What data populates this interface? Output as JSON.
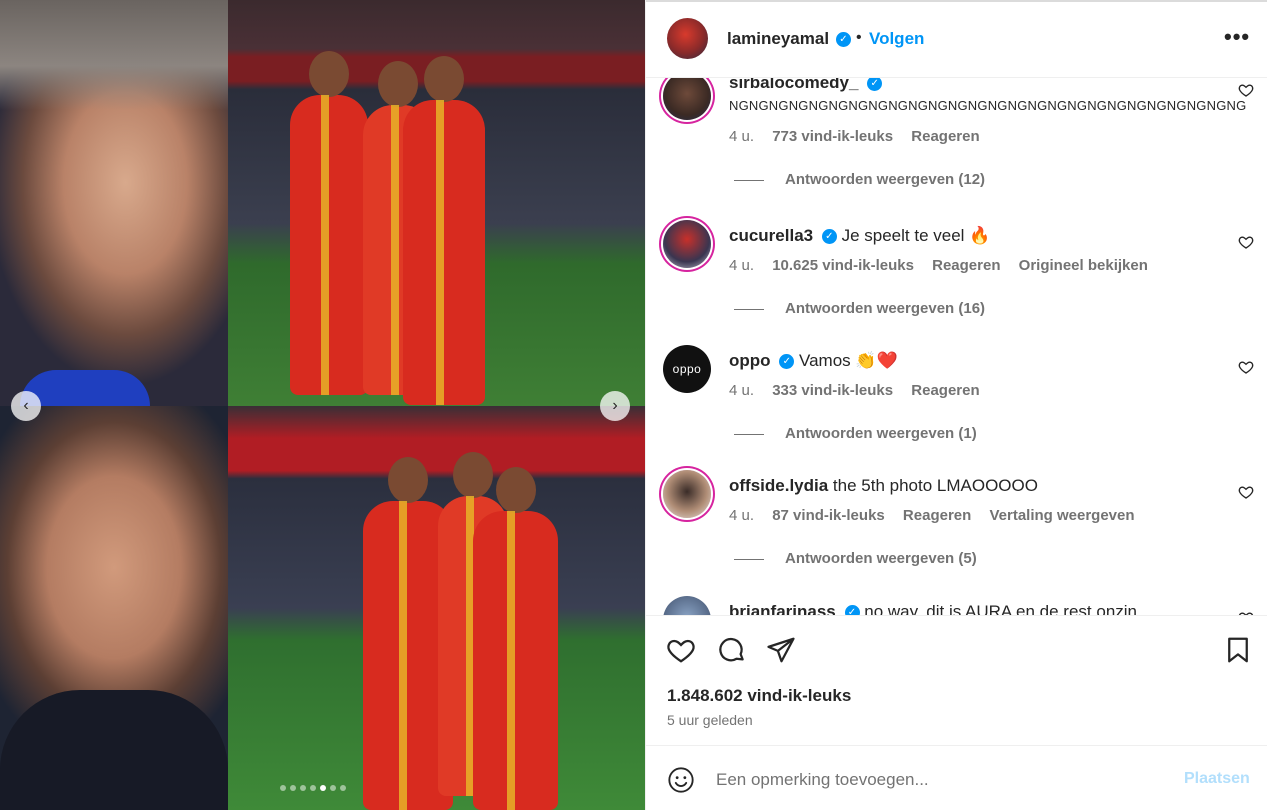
{
  "media": {
    "prev_icon": "chevron-left-icon",
    "next_icon": "chevron-right-icon",
    "carousel_total": 7,
    "carousel_active_index": 4
  },
  "post": {
    "owner": "lamineyamal",
    "separator": "•",
    "follow_label": "Volgen",
    "more_label": "•••",
    "likes": "1.848.602 vind-ik-leuks",
    "time": "5 uur geleden"
  },
  "comments": [
    {
      "user": "sirbalocomedy_",
      "text": "NGNGNGNGNGNGNGNGNGNGNGNGNGNGNGNGNGNGNGNGNGNGNGNGNGNG",
      "time": "4 u.",
      "likes": "773 vind-ik-leuks",
      "reply": "Reageren",
      "extra": "",
      "replies": "Antwoorden weergeven (12)"
    },
    {
      "user": "cucurella3",
      "text": "Je speelt te veel 🔥",
      "time": "4 u.",
      "likes": "10.625 vind-ik-leuks",
      "reply": "Reageren",
      "extra": "Origineel bekijken",
      "replies": "Antwoorden weergeven (16)"
    },
    {
      "user": "oppo",
      "avatar_text": "oppo",
      "text": "Vamos 👏❤️",
      "time": "4 u.",
      "likes": "333 vind-ik-leuks",
      "reply": "Reageren",
      "extra": "",
      "replies": "Antwoorden weergeven (1)"
    },
    {
      "user": "offside.lydia",
      "text": "the 5th photo LMAOOOOO",
      "time": "4 u.",
      "likes": "87 vind-ik-leuks",
      "reply": "Reageren",
      "extra": "Vertaling weergeven",
      "replies": "Antwoorden weergeven (5)"
    },
    {
      "user": "brianfarinass",
      "text": "no way, dit is AURA en de rest onzin"
    }
  ],
  "composer": {
    "placeholder": "Een opmerking toevoegen...",
    "post_label": "Plaatsen"
  },
  "colors": {
    "accent": "#0095f6",
    "text": "#262626",
    "muted": "#737373",
    "post_disabled": "#b2dffc"
  }
}
